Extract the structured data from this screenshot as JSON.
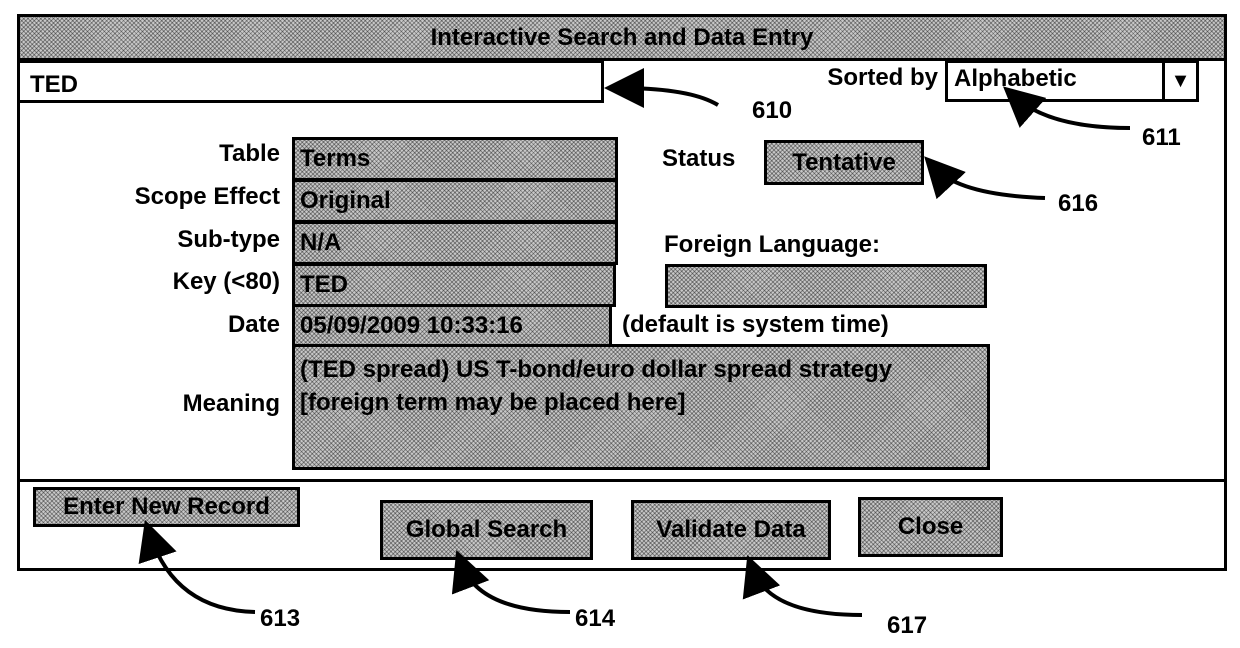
{
  "window": {
    "title": "Interactive Search and Data Entry"
  },
  "search": {
    "value": "TED"
  },
  "sort": {
    "label": "Sorted by",
    "selected": "Alphabetic"
  },
  "form": {
    "table": {
      "label": "Table",
      "value": "Terms"
    },
    "scope_effect": {
      "label": "Scope Effect",
      "value": "Original"
    },
    "sub_type": {
      "label": "Sub-type",
      "value": "N/A"
    },
    "key": {
      "label": "Key (<80)",
      "value": "TED"
    },
    "date": {
      "label": "Date",
      "value": "05/09/2009 10:33:16",
      "hint": "(default is system time)"
    },
    "meaning": {
      "label": "Meaning",
      "value": "(TED spread) US T-bond/euro dollar spread strategy [foreign term may be placed here]"
    },
    "status": {
      "label": "Status",
      "value": "Tentative"
    },
    "foreign_language": {
      "label": "Foreign Language:",
      "value": ""
    }
  },
  "buttons": {
    "enter_new_record": "Enter New Record",
    "global_search": "Global Search",
    "validate_data": "Validate Data",
    "close": "Close"
  },
  "callouts": {
    "search_field": "610",
    "sort_select": "611",
    "enter_new_record": "613",
    "global_search": "614",
    "status": "616",
    "validate_data": "617"
  },
  "icons": {
    "dropdown": "triangle-down-icon"
  }
}
